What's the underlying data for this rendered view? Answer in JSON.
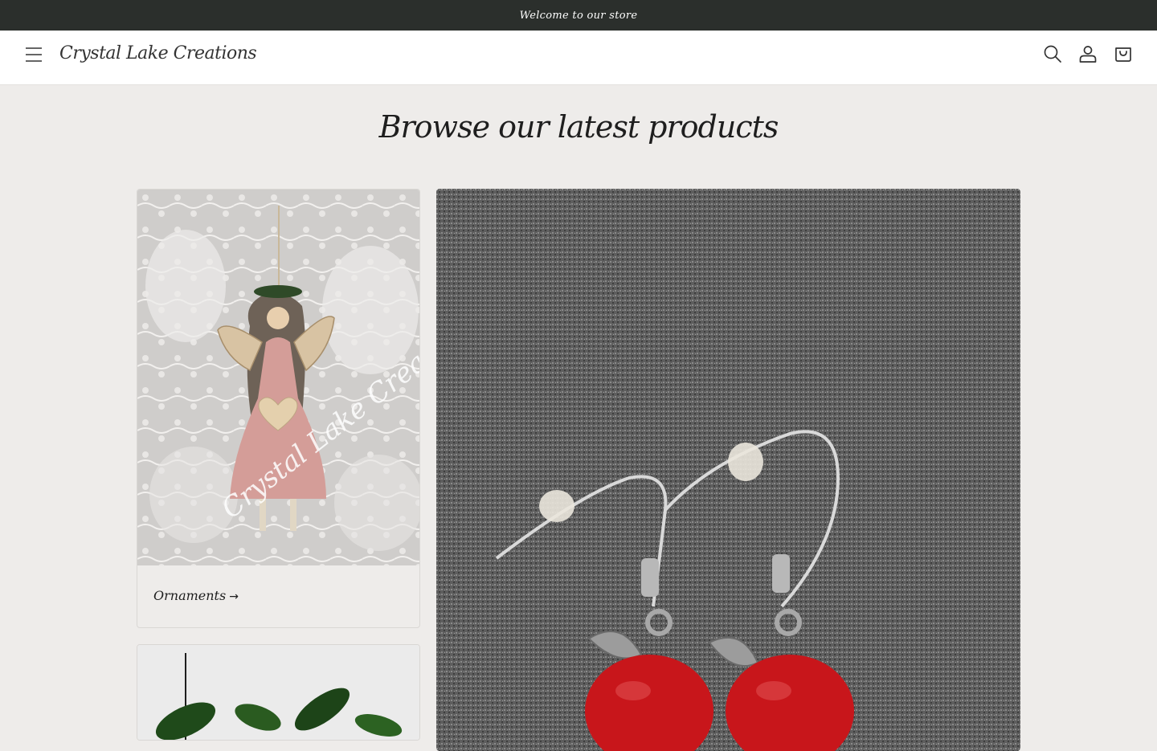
{
  "announcement": {
    "text": "Welcome to our store"
  },
  "header": {
    "brand": "Crystal Lake Creations",
    "icons": [
      "menu-icon",
      "search-icon",
      "account-icon",
      "cart-icon"
    ]
  },
  "main": {
    "title": "Browse our latest products",
    "collections": [
      {
        "label": "Ornaments",
        "arrow": "→"
      }
    ]
  },
  "colors": {
    "announcement_bg": "#2b2f2c",
    "page_bg": "#eeecea",
    "apple_red": "#c8161b"
  }
}
